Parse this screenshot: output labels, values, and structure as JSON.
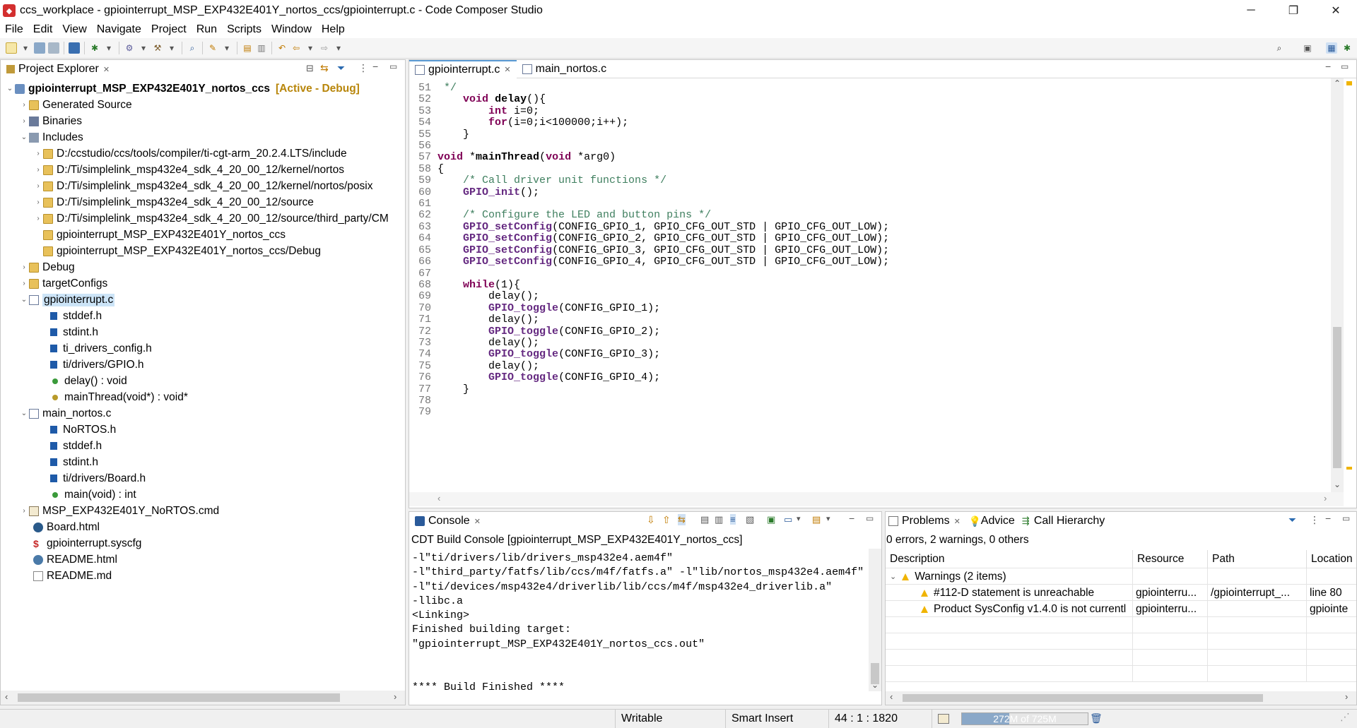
{
  "window": {
    "title": "ccs_workplace - gpiointerrupt_MSP_EXP432E401Y_nortos_ccs/gpiointerrupt.c - Code Composer Studio",
    "controls": [
      "─",
      "❐",
      "✕"
    ]
  },
  "menu": [
    "File",
    "Edit",
    "View",
    "Navigate",
    "Project",
    "Run",
    "Scripts",
    "Window",
    "Help"
  ],
  "project_explorer": {
    "tab_label": "Project Explorer",
    "project_name": "gpiointerrupt_MSP_EXP432E401Y_nortos_ccs",
    "project_state": "[Active - Debug]",
    "items": [
      {
        "label": "Generated Source"
      },
      {
        "label": "Binaries"
      },
      {
        "label": "Includes"
      },
      {
        "label": "D:/ccstudio/ccs/tools/compiler/ti-cgt-arm_20.2.4.LTS/include"
      },
      {
        "label": "D:/Ti/simplelink_msp432e4_sdk_4_20_00_12/kernel/nortos"
      },
      {
        "label": "D:/Ti/simplelink_msp432e4_sdk_4_20_00_12/kernel/nortos/posix"
      },
      {
        "label": "D:/Ti/simplelink_msp432e4_sdk_4_20_00_12/source"
      },
      {
        "label": "D:/Ti/simplelink_msp432e4_sdk_4_20_00_12/source/third_party/CM"
      },
      {
        "label": "gpiointerrupt_MSP_EXP432E401Y_nortos_ccs"
      },
      {
        "label": "gpiointerrupt_MSP_EXP432E401Y_nortos_ccs/Debug"
      },
      {
        "label": "Debug"
      },
      {
        "label": "targetConfigs"
      },
      {
        "label": "gpiointerrupt.c"
      },
      {
        "label": "stddef.h"
      },
      {
        "label": "stdint.h"
      },
      {
        "label": "ti_drivers_config.h"
      },
      {
        "label": "ti/drivers/GPIO.h"
      },
      {
        "label": "delay() : void"
      },
      {
        "label": "mainThread(void*) : void*"
      },
      {
        "label": "main_nortos.c"
      },
      {
        "label": "NoRTOS.h"
      },
      {
        "label": "stddef.h"
      },
      {
        "label": "stdint.h"
      },
      {
        "label": "ti/drivers/Board.h"
      },
      {
        "label": "main(void) : int"
      },
      {
        "label": "MSP_EXP432E401Y_NoRTOS.cmd"
      },
      {
        "label": "Board.html"
      },
      {
        "label": "gpiointerrupt.syscfg"
      },
      {
        "label": "README.html"
      },
      {
        "label": "README.md"
      }
    ]
  },
  "editor": {
    "tabs": [
      "gpiointerrupt.c",
      "main_nortos.c"
    ],
    "lines": [
      {
        "n": "51",
        "t": " */"
      },
      {
        "n": "52",
        "t": "    void delay(){"
      },
      {
        "n": "53",
        "t": "        int i=0;"
      },
      {
        "n": "54",
        "t": "        for(i=0;i<100000;i++);"
      },
      {
        "n": "55",
        "t": "    }"
      },
      {
        "n": "56",
        "t": ""
      },
      {
        "n": "57",
        "t": "void *mainThread(void *arg0)"
      },
      {
        "n": "58",
        "t": "{"
      },
      {
        "n": "59",
        "t": "    /* Call driver unit functions */"
      },
      {
        "n": "60",
        "t": "    GPIO_init();"
      },
      {
        "n": "61",
        "t": ""
      },
      {
        "n": "62",
        "t": "    /* Configure the LED and button pins */"
      },
      {
        "n": "63",
        "t": "    GPIO_setConfig(CONFIG_GPIO_1, GPIO_CFG_OUT_STD | GPIO_CFG_OUT_LOW);"
      },
      {
        "n": "64",
        "t": "    GPIO_setConfig(CONFIG_GPIO_2, GPIO_CFG_OUT_STD | GPIO_CFG_OUT_LOW);"
      },
      {
        "n": "65",
        "t": "    GPIO_setConfig(CONFIG_GPIO_3, GPIO_CFG_OUT_STD | GPIO_CFG_OUT_LOW);"
      },
      {
        "n": "66",
        "t": "    GPIO_setConfig(CONFIG_GPIO_4, GPIO_CFG_OUT_STD | GPIO_CFG_OUT_LOW);"
      },
      {
        "n": "67",
        "t": ""
      },
      {
        "n": "68",
        "t": "    while(1){"
      },
      {
        "n": "69",
        "t": "        delay();"
      },
      {
        "n": "70",
        "t": "        GPIO_toggle(CONFIG_GPIO_1);"
      },
      {
        "n": "71",
        "t": "        delay();"
      },
      {
        "n": "72",
        "t": "        GPIO_toggle(CONFIG_GPIO_2);"
      },
      {
        "n": "73",
        "t": "        delay();"
      },
      {
        "n": "74",
        "t": "        GPIO_toggle(CONFIG_GPIO_3);"
      },
      {
        "n": "75",
        "t": "        delay();"
      },
      {
        "n": "76",
        "t": "        GPIO_toggle(CONFIG_GPIO_4);"
      },
      {
        "n": "77",
        "t": "    }"
      },
      {
        "n": "78",
        "t": ""
      },
      {
        "n": "79",
        "t": ""
      }
    ]
  },
  "console": {
    "tab_label": "Console",
    "header": "CDT Build Console [gpiointerrupt_MSP_EXP432E401Y_nortos_ccs]",
    "lines": [
      "-l\"ti/drivers/lib/drivers_msp432e4.aem4f\"",
      "-l\"third_party/fatfs/lib/ccs/m4f/fatfs.a\" -l\"lib/nortos_msp432e4.aem4f\"",
      "-l\"ti/devices/msp432e4/driverlib/lib/ccs/m4f/msp432e4_driverlib.a\"",
      "-llibc.a",
      "<Linking>",
      "Finished building target:",
      "\"gpiointerrupt_MSP_EXP432E401Y_nortos_ccs.out\"",
      "",
      "",
      "**** Build Finished ****"
    ]
  },
  "problems": {
    "tabs": [
      "Problems",
      "Advice",
      "Call Hierarchy"
    ],
    "summary": "0 errors, 2 warnings, 0 others",
    "columns": [
      "Description",
      "Resource",
      "Path",
      "Location"
    ],
    "group": "Warnings (2 items)",
    "rows": [
      {
        "description": "#112-D statement is unreachable",
        "resource": "gpiointerru...",
        "path": "/gpiointerrupt_...",
        "location": "line 80"
      },
      {
        "description": "Product SysConfig v1.4.0 is not currentl",
        "resource": "gpiointerru...",
        "path": "",
        "location": "gpiointe"
      }
    ]
  },
  "status": {
    "writable": "Writable",
    "insert_mode": "Smart Insert",
    "position": "44 : 1 : 1820",
    "memory": "272M of 725M",
    "memory_fraction": 0.375
  }
}
